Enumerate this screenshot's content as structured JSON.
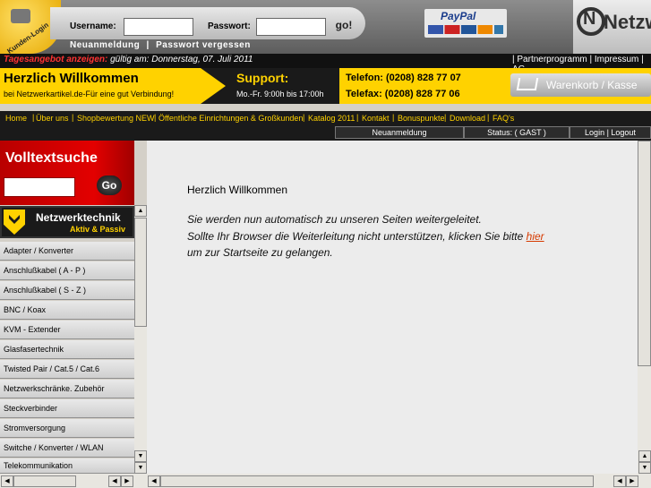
{
  "header": {
    "badge_text": "Kunden-Login",
    "username_label": "Username:",
    "password_label": "Passwort:",
    "go_label": "go!",
    "register_link": "Neuanmeldung",
    "forgot_link": "Passwort vergessen",
    "separator": "|",
    "paypal_label": "PayPal",
    "brand_text": "Netzw",
    "brand_initial": "N"
  },
  "tagesangebot": {
    "label": "Tagesangebot anzeigen:",
    "text": "gültig am: Donnerstag, 07. Juli 2011",
    "top_links": "| Partnerprogramm   | Impressum | AG"
  },
  "welcome_bar": {
    "title": "Herzlich Willkommen",
    "subtitle": "bei Netzwerkartikel.de-Für eine gut Verbindung!",
    "support_label": "Support:",
    "hours": "Mo.-Fr. 9:00h bis 17:00h",
    "phone": "Telefon: (0208) 828 77 07",
    "fax": "Telefax: (0208) 828 77 06",
    "cart_label": "Warenkorb / Kasse"
  },
  "nav": [
    "Home",
    "Über uns",
    "Shopbewertung NEW",
    "Öffentliche Einrichtungen & Großkunden",
    "Katalog 2011",
    "Kontakt",
    "Bonuspunkte",
    "Download",
    "FAQ's"
  ],
  "subnav": {
    "register": "Neuanmeldung",
    "status": "Status: ( GAST )",
    "login": "Login | Logout"
  },
  "search": {
    "title": "Volltextsuche",
    "go_label": "Go"
  },
  "category": {
    "title": "Netzwerktechnik",
    "subtitle": "Aktiv & Passiv",
    "items": [
      "Adapter / Konverter",
      "Anschlußkabel ( A - P )",
      "Anschlußkabel ( S - Z )",
      "BNC / Koax",
      "KVM - Extender",
      "Glasfasertechnik",
      "Twisted Pair / Cat.5 / Cat.6",
      "Netzwerkschränke. Zubehör",
      "Steckverbinder",
      "Stromversorgung",
      "Switche / Konverter / WLAN",
      "Telekommunikation"
    ]
  },
  "main": {
    "heading": "Herzlich Willkommen",
    "line1": "Sie werden nun automatisch zu unseren Seiten weitergeleitet.",
    "line2": "Sollte Ihr Browser die Weiterleitung nicht unterstützen, klicken Sie bitte",
    "link": "hier",
    "line3": "um zur Startseite zu gelangen."
  },
  "scroll": {
    "up": "▲",
    "down": "▼",
    "left": "◀",
    "right": "▶"
  }
}
